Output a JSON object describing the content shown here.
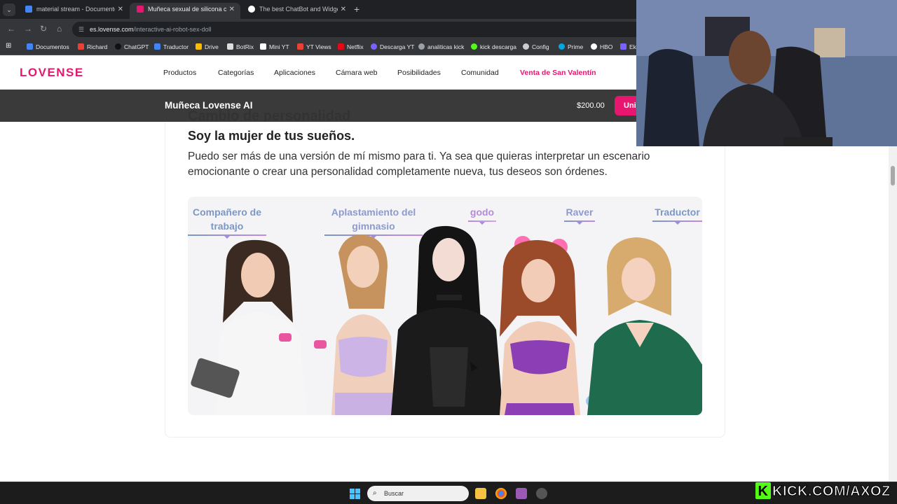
{
  "browser": {
    "tabs": [
      {
        "title": "material stream - Documentos",
        "color": "#4285f4",
        "active": false
      },
      {
        "title": "Muñeca sexual de silicona con",
        "color": "#e7176f",
        "active": true
      },
      {
        "title": "The best ChatBot and Widgets",
        "color": "#ffffff",
        "active": false
      }
    ],
    "url_domain": "es.lovense.com",
    "url_path": "/interactive-ai-robot-sex-doll",
    "bookmarks": [
      {
        "label": "Documentos",
        "color": "#4285f4"
      },
      {
        "label": "Richard",
        "color": "#e94235"
      },
      {
        "label": "ChatGPT",
        "color": "#111111"
      },
      {
        "label": "Traductor",
        "color": "#4285f4"
      },
      {
        "label": "Drive",
        "color": "#fbbc04"
      },
      {
        "label": "BotRix",
        "color": "#dddddd"
      },
      {
        "label": "Mini YT",
        "color": "#ffffff"
      },
      {
        "label": "YT Views",
        "color": "#e94235"
      },
      {
        "label": "Netflix",
        "color": "#e50914"
      },
      {
        "label": "Descarga YT",
        "color": "#7b61ff"
      },
      {
        "label": "analiticas kick",
        "color": "#9aa0a6"
      },
      {
        "label": "kick descarga",
        "color": "#53fc18"
      },
      {
        "label": "Config",
        "color": "#cccccc"
      },
      {
        "label": "Prime",
        "color": "#00a8e1"
      },
      {
        "label": "HBO",
        "color": "#ffffff"
      },
      {
        "label": "Ek",
        "color": "#7b61ff"
      }
    ]
  },
  "site": {
    "logo": "LOVENSE",
    "brand_color": "#e7176f",
    "nav": [
      "Productos",
      "Categorías",
      "Aplicaciones",
      "Cámara web",
      "Posibilidades",
      "Comunidad",
      "Venta de San Valentín"
    ],
    "product_bar": {
      "name": "Muñeca Lovense AI",
      "price": "$200.00",
      "button": "Uni"
    }
  },
  "content": {
    "peek_title": "Cambio de personalidad",
    "subtitle": "Soy la mujer de tus sueños.",
    "description": "Puedo ser más de una versión de mí mismo para ti. Ya sea que quieras interpretar un escenario emocionante o crear una personalidad completamente nueva, tus deseos son órdenes.",
    "personas": [
      {
        "label": "Compañero de trabajo"
      },
      {
        "label": "Aplastamiento del gimnasio"
      },
      {
        "label": "godo"
      },
      {
        "label": "Raver"
      },
      {
        "label": "Traductor"
      }
    ]
  },
  "taskbar": {
    "search_placeholder": "Buscar",
    "stream_overlay": "KICK.COM/AXOZ"
  }
}
